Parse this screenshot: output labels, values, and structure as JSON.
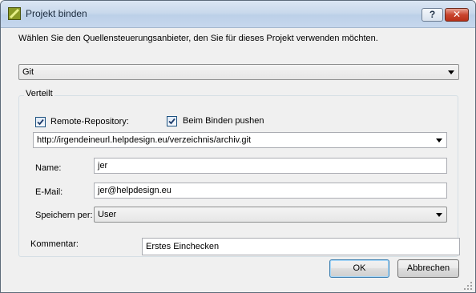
{
  "window": {
    "title": "Projekt binden",
    "help_label": "?",
    "close_label": "✕"
  },
  "intro": "Wählen Sie den Quellensteuerungsanbieter, den Sie für dieses Projekt verwenden möchten.",
  "provider": {
    "value": "Git"
  },
  "group": {
    "title": "Verteilt",
    "remote_repo": {
      "label": "Remote-Repository:",
      "checked": true
    },
    "push_on_bind": {
      "label": "Beim Binden pushen",
      "checked": true
    },
    "repo_url": "http://irgendeineurl.helpdesign.eu/verzeichnis/archiv.git",
    "name": {
      "label": "Name:",
      "value": "jer"
    },
    "email": {
      "label": "E-Mail:",
      "value": "jer@helpdesign.eu"
    },
    "store": {
      "label": "Speichern per:",
      "value": "User"
    }
  },
  "comment": {
    "label": "Kommentar:",
    "value": "Erstes Einchecken"
  },
  "buttons": {
    "ok": "OK",
    "cancel": "Abbrechen"
  },
  "icons": {
    "app": "project-icon",
    "help": "help-icon",
    "close": "close-icon",
    "dropdown": "chevron-down-icon",
    "check": "checkmark-icon",
    "grip": "resize-grip-icon"
  },
  "colors": {
    "titlebar": "#c9d9ec",
    "close": "#c9452f",
    "accent": "#3c7fb1"
  }
}
